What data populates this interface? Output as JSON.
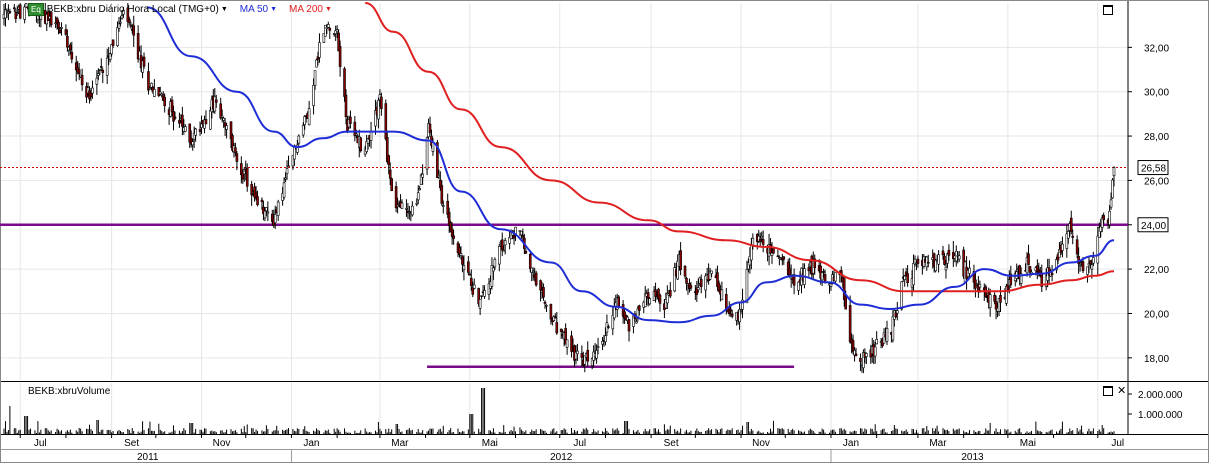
{
  "legend": {
    "badge": "Eq",
    "symbol_title": "BEKB:xbru Diário Hora Local (TMG+0)",
    "ma50_label": "MA 50",
    "ma200_label": "MA 200"
  },
  "volume_title": "BEKB:xbruVolume",
  "colors": {
    "candle_up": "#ffffff",
    "candle_down": "#8b0000",
    "wick": "#000000",
    "ma50": "#1f2dd6",
    "ma200": "#e02020",
    "horizontal_line": "#7a0a8a",
    "last_price_line": "#cc0000",
    "grid": "#e6e6e6"
  },
  "chart_data": [
    {
      "type": "candlestick",
      "title": "BEKB:xbru Diário Hora Local (TMG+0)",
      "y_axis_side": "right",
      "ylim": [
        17.0,
        34.0
      ],
      "y_ticks": [
        "18,00",
        "20,00",
        "22,00",
        "24,00",
        "26,00",
        "28,00",
        "30,00",
        "32,00"
      ],
      "x_month_labels": [
        "Jul",
        "Set",
        "Nov",
        "Jan",
        "Mar",
        "Mai",
        "Jul",
        "Set",
        "Nov",
        "Jan",
        "Mar",
        "Mai",
        "Jul"
      ],
      "x_year_labels": [
        "2011",
        "2012",
        "2013"
      ],
      "x_range": [
        "2011-06-20",
        "2013-07-12"
      ],
      "price_markers": [
        {
          "label": "26,58",
          "value": 26.58,
          "style": "dotted-red"
        },
        {
          "label": "24,00",
          "value": 24.0,
          "style": "purple-horizontal"
        }
      ],
      "support_line": {
        "value": 17.6,
        "from": "2012-04-02",
        "to": "2012-12-07"
      },
      "close_path": [
        [
          "2011-06-20",
          33.4
        ],
        [
          "2011-07-10",
          33.8
        ],
        [
          "2011-08-01",
          32.6
        ],
        [
          "2011-08-15",
          29.8
        ],
        [
          "2011-08-25",
          31.0
        ],
        [
          "2011-09-10",
          33.6
        ],
        [
          "2011-09-25",
          30.5
        ],
        [
          "2011-10-08",
          29.5
        ],
        [
          "2011-10-25",
          27.8
        ],
        [
          "2011-11-10",
          29.6
        ],
        [
          "2011-11-25",
          27.0
        ],
        [
          "2011-12-08",
          25.0
        ],
        [
          "2011-12-20",
          24.2
        ],
        [
          "2012-01-05",
          27.8
        ],
        [
          "2012-01-12",
          29.0
        ],
        [
          "2012-01-22",
          32.8
        ],
        [
          "2012-01-31",
          33.0
        ],
        [
          "2012-02-08",
          28.5
        ],
        [
          "2012-02-20",
          27.4
        ],
        [
          "2012-03-01",
          29.8
        ],
        [
          "2012-03-10",
          25.0
        ],
        [
          "2012-03-25",
          24.5
        ],
        [
          "2012-04-03",
          28.4
        ],
        [
          "2012-04-14",
          24.6
        ],
        [
          "2012-04-25",
          22.4
        ],
        [
          "2012-05-08",
          20.5
        ],
        [
          "2012-05-22",
          22.9
        ],
        [
          "2012-06-03",
          23.9
        ],
        [
          "2012-06-12",
          21.8
        ],
        [
          "2012-06-25",
          19.8
        ],
        [
          "2012-07-06",
          18.6
        ],
        [
          "2012-07-16",
          17.8
        ],
        [
          "2012-07-28",
          18.3
        ],
        [
          "2012-08-08",
          20.6
        ],
        [
          "2012-08-18",
          19.4
        ],
        [
          "2012-08-30",
          21.0
        ],
        [
          "2012-09-10",
          20.3
        ],
        [
          "2012-09-20",
          22.4
        ],
        [
          "2012-10-01",
          21.0
        ],
        [
          "2012-10-12",
          21.8
        ],
        [
          "2012-10-22",
          20.2
        ],
        [
          "2012-11-01",
          20.0
        ],
        [
          "2012-11-10",
          23.8
        ],
        [
          "2012-11-18",
          22.9
        ],
        [
          "2012-11-28",
          22.5
        ],
        [
          "2012-12-08",
          21.5
        ],
        [
          "2012-12-18",
          22.2
        ],
        [
          "2012-12-31",
          21.5
        ],
        [
          "2013-01-08",
          21.8
        ],
        [
          "2013-01-14",
          18.5
        ],
        [
          "2013-01-21",
          17.9
        ],
        [
          "2013-01-31",
          18.4
        ],
        [
          "2013-02-10",
          19.2
        ],
        [
          "2013-02-20",
          21.6
        ],
        [
          "2013-03-02",
          22.3
        ],
        [
          "2013-03-14",
          22.3
        ],
        [
          "2013-03-26",
          22.6
        ],
        [
          "2013-04-06",
          21.6
        ],
        [
          "2013-04-15",
          20.9
        ],
        [
          "2013-04-25",
          20.4
        ],
        [
          "2013-05-04",
          21.4
        ],
        [
          "2013-05-14",
          22.2
        ],
        [
          "2013-05-24",
          21.6
        ],
        [
          "2013-06-03",
          22.2
        ],
        [
          "2013-06-13",
          24.0
        ],
        [
          "2013-06-18",
          22.4
        ],
        [
          "2013-06-23",
          21.7
        ],
        [
          "2013-06-29",
          22.5
        ],
        [
          "2013-07-04",
          24.4
        ],
        [
          "2013-07-08",
          24.1
        ],
        [
          "2013-07-12",
          26.58
        ]
      ],
      "ma50_path": [
        [
          "2011-09-25",
          33.8
        ],
        [
          "2011-10-25",
          31.6
        ],
        [
          "2011-11-25",
          30.0
        ],
        [
          "2011-12-20",
          28.2
        ],
        [
          "2012-01-05",
          27.5
        ],
        [
          "2012-01-22",
          27.9
        ],
        [
          "2012-02-08",
          28.2
        ],
        [
          "2012-03-10",
          28.2
        ],
        [
          "2012-04-03",
          27.8
        ],
        [
          "2012-04-25",
          25.5
        ],
        [
          "2012-05-22",
          23.8
        ],
        [
          "2012-06-25",
          22.3
        ],
        [
          "2012-07-16",
          21.0
        ],
        [
          "2012-08-08",
          20.3
        ],
        [
          "2012-08-30",
          19.7
        ],
        [
          "2012-09-20",
          19.6
        ],
        [
          "2012-10-12",
          19.9
        ],
        [
          "2012-11-01",
          20.5
        ],
        [
          "2012-11-18",
          21.4
        ],
        [
          "2012-12-08",
          21.7
        ],
        [
          "2012-12-31",
          21.4
        ],
        [
          "2013-01-21",
          20.4
        ],
        [
          "2013-02-10",
          20.2
        ],
        [
          "2013-03-02",
          20.4
        ],
        [
          "2013-03-26",
          21.2
        ],
        [
          "2013-04-15",
          22.0
        ],
        [
          "2013-05-04",
          21.7
        ],
        [
          "2013-05-24",
          21.8
        ],
        [
          "2013-06-13",
          22.3
        ],
        [
          "2013-06-29",
          22.6
        ],
        [
          "2013-07-12",
          23.3
        ]
      ],
      "ma200_path": [
        [
          "2012-02-20",
          34.0
        ],
        [
          "2012-03-10",
          32.7
        ],
        [
          "2012-04-03",
          30.9
        ],
        [
          "2012-04-25",
          29.2
        ],
        [
          "2012-05-22",
          27.5
        ],
        [
          "2012-06-25",
          26.0
        ],
        [
          "2012-07-28",
          25.0
        ],
        [
          "2012-08-30",
          24.2
        ],
        [
          "2012-09-20",
          23.7
        ],
        [
          "2012-10-22",
          23.3
        ],
        [
          "2012-11-18",
          23.0
        ],
        [
          "2012-12-18",
          22.4
        ],
        [
          "2013-01-21",
          21.5
        ],
        [
          "2013-02-20",
          21.0
        ],
        [
          "2013-03-26",
          21.0
        ],
        [
          "2013-04-25",
          21.0
        ],
        [
          "2013-05-24",
          21.3
        ],
        [
          "2013-06-13",
          21.5
        ],
        [
          "2013-06-29",
          21.7
        ],
        [
          "2013-07-12",
          21.9
        ]
      ]
    },
    {
      "type": "bar",
      "title": "BEKB:xbruVolume",
      "y_axis_side": "right",
      "ylim": [
        0,
        2400000
      ],
      "y_ticks": [
        "1.000.000",
        "2.000.000"
      ],
      "y_tick_values": [
        1000000,
        2000000
      ],
      "spikes": [
        [
          "2011-06-25",
          1400000
        ],
        [
          "2011-07-05",
          900000
        ],
        [
          "2011-08-22",
          700000
        ],
        [
          "2011-10-25",
          550000
        ],
        [
          "2012-03-12",
          500000
        ],
        [
          "2012-05-10",
          2300000
        ],
        [
          "2012-05-02",
          1000000
        ],
        [
          "2012-08-15",
          650000
        ],
        [
          "2012-11-05",
          600000
        ],
        [
          "2013-04-20",
          550000
        ]
      ],
      "typical_range": [
        50000,
        300000
      ]
    }
  ]
}
